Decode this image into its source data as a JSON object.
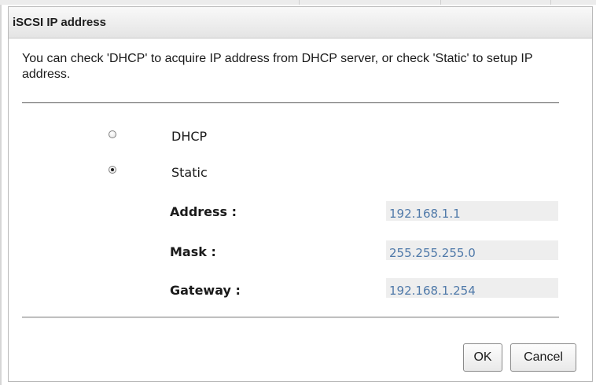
{
  "dialog": {
    "title": "iSCSI IP address",
    "description": "You can check 'DHCP' to acquire IP address from DHCP server, or check 'Static' to setup IP address."
  },
  "mode": {
    "options": [
      {
        "label": "DHCP",
        "selected": false
      },
      {
        "label": "Static",
        "selected": true
      }
    ]
  },
  "fields": {
    "address": {
      "label": "Address :",
      "value": "192.168.1.1"
    },
    "mask": {
      "label": "Mask :",
      "value": "255.255.255.0"
    },
    "gateway": {
      "label": "Gateway :",
      "value": "192.168.1.254"
    }
  },
  "buttons": {
    "ok": "OK",
    "cancel": "Cancel"
  },
  "colors": {
    "value_text": "#4f79a9",
    "value_background": "#eeeeee"
  }
}
